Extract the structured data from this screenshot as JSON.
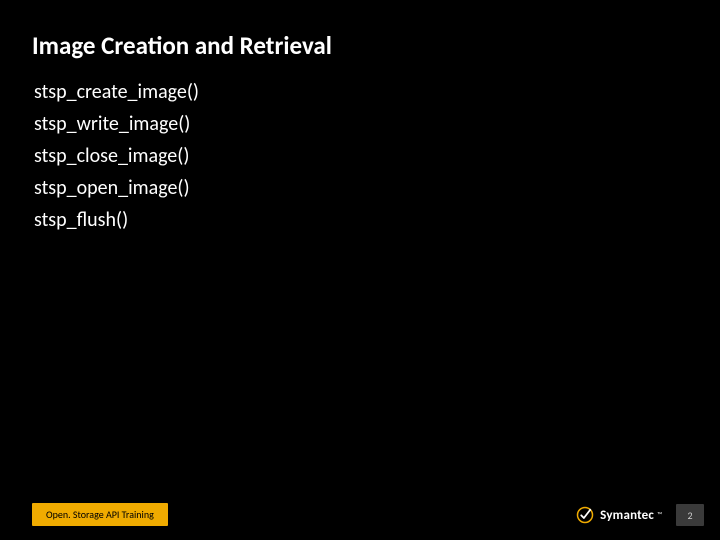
{
  "title": "Image Creation and Retrieval",
  "items": [
    "stsp_create_image()",
    "stsp_write_image()",
    "stsp_close_image()",
    "stsp_open_image()",
    "stsp_flush()"
  ],
  "footer": {
    "chip": "Open. Storage API Training",
    "brand": "Symantec",
    "tm": "™",
    "page": "2"
  },
  "colors": {
    "accent": "#f0ab00",
    "bg": "#000000",
    "text": "#ffffff"
  }
}
